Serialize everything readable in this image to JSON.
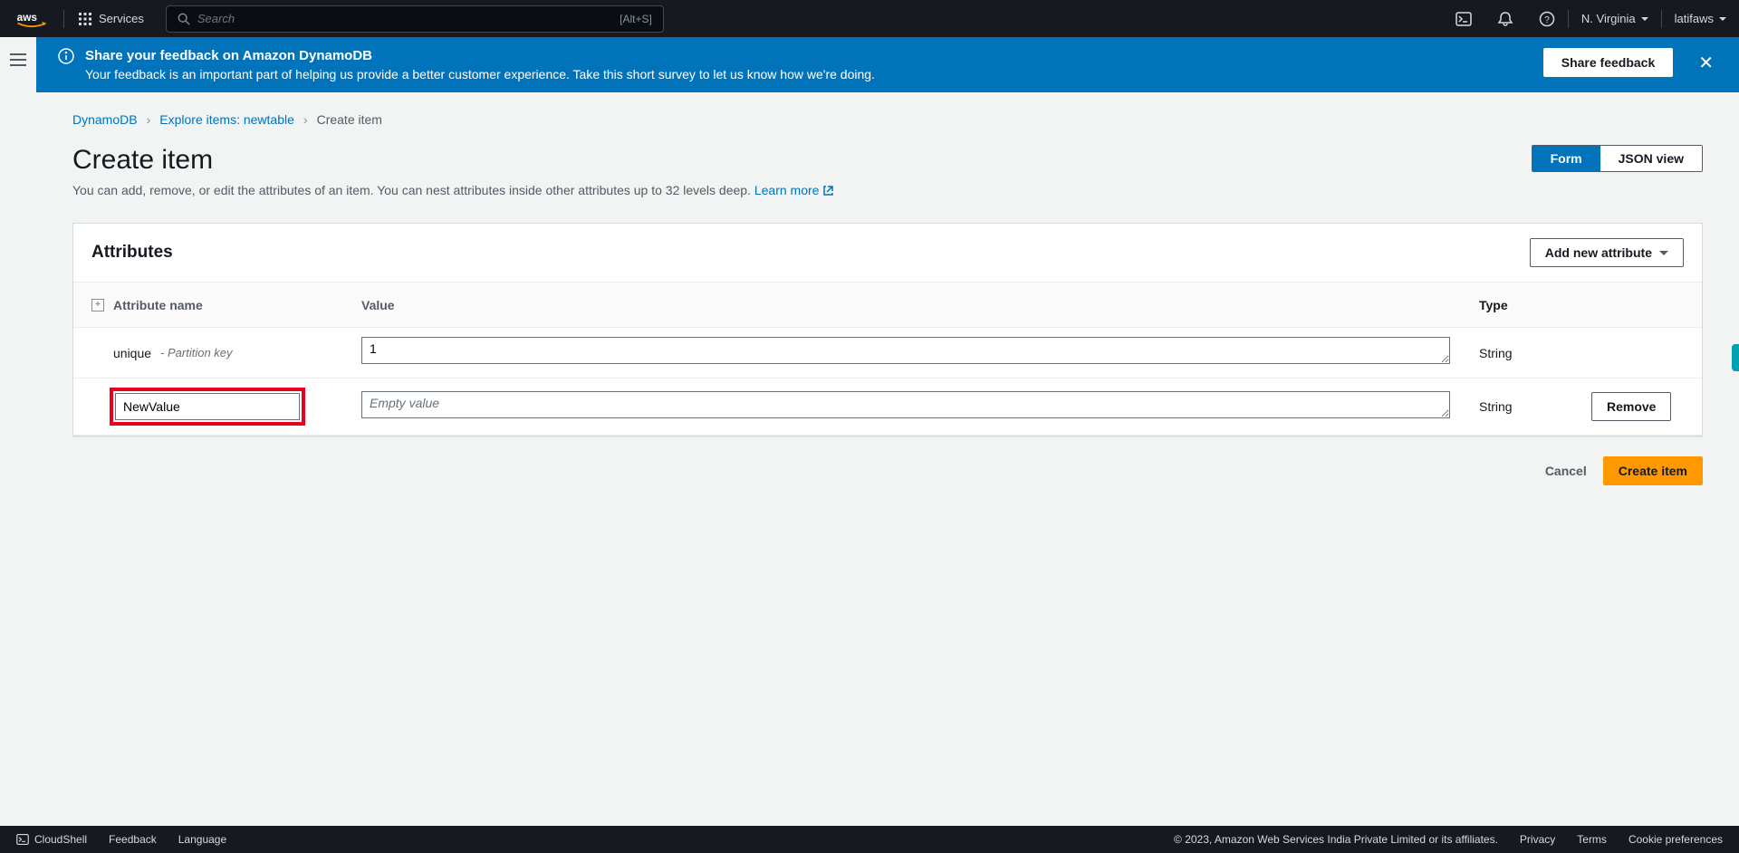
{
  "topnav": {
    "services_label": "Services",
    "search_placeholder": "Search",
    "search_kbd": "[Alt+S]",
    "region": "N. Virginia",
    "user": "latifaws"
  },
  "banner": {
    "title": "Share your feedback on Amazon DynamoDB",
    "subtitle": "Your feedback is an important part of helping us provide a better customer experience. Take this short survey to let us know how we're doing.",
    "button": "Share feedback"
  },
  "breadcrumb": {
    "root": "DynamoDB",
    "mid": "Explore items: newtable",
    "leaf": "Create item"
  },
  "page": {
    "title": "Create item",
    "desc_pre": "You can add, remove, or edit the attributes of an item. You can nest attributes inside other attributes up to 32 levels deep. ",
    "learn_more": "Learn more",
    "view_form": "Form",
    "view_json": "JSON view"
  },
  "panel": {
    "title": "Attributes",
    "add_btn": "Add new attribute",
    "col_name": "Attribute name",
    "col_value": "Value",
    "col_type": "Type"
  },
  "rows": [
    {
      "name": "unique",
      "hint": "- Partition key",
      "value": "1",
      "placeholder": "",
      "type": "String",
      "removable": false,
      "name_editable": false
    },
    {
      "name": "NewValue",
      "hint": "",
      "value": "",
      "placeholder": "Empty value",
      "type": "String",
      "removable": true,
      "name_editable": true
    }
  ],
  "actions": {
    "remove": "Remove",
    "cancel": "Cancel",
    "create": "Create item"
  },
  "footer": {
    "cloudshell": "CloudShell",
    "feedback": "Feedback",
    "language": "Language",
    "copyright": "© 2023, Amazon Web Services India Private Limited or its affiliates.",
    "privacy": "Privacy",
    "terms": "Terms",
    "cookies": "Cookie preferences"
  }
}
